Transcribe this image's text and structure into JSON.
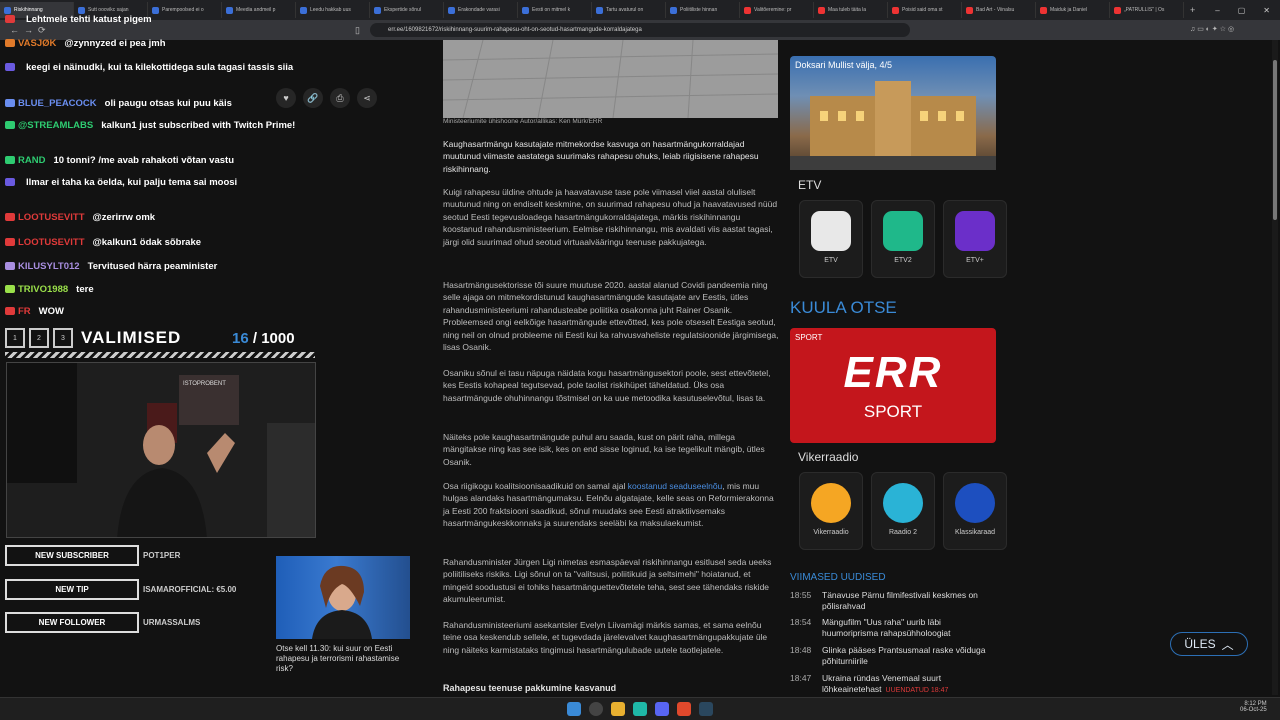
{
  "tabs": [
    {
      "label": "Riskihinnang",
      "active": true,
      "icon": "err-favicon"
    },
    {
      "label": "Sutt ooovikc sajan",
      "icon": "err-favicon"
    },
    {
      "label": "Parempoolsed ei o",
      "icon": "err-favicon"
    },
    {
      "label": "Meedia andmeil p",
      "icon": "err-favicon"
    },
    {
      "label": "Leedu hakkab uus",
      "icon": "err-favicon"
    },
    {
      "label": "Ekspertide sõnul",
      "icon": "err-favicon"
    },
    {
      "label": "Erakondade varasi",
      "icon": "err-favicon"
    },
    {
      "label": "Eesti on mitmel k",
      "icon": "err-favicon"
    },
    {
      "label": "Tartu avaturul on",
      "icon": "err-favicon"
    },
    {
      "label": "Poliitiliste hinnan",
      "icon": "err-favicon"
    },
    {
      "label": "Valitõeremine: pr",
      "icon": "red-favicon"
    },
    {
      "label": "Maa tuleb täita la",
      "icon": "red-favicon"
    },
    {
      "label": "Poisid said oma st",
      "icon": "red-favicon"
    },
    {
      "label": "Bad Art - Viinalsu",
      "icon": "youtube-favicon"
    },
    {
      "label": "Maiduk ja Daniel",
      "icon": "youtube-favicon"
    },
    {
      "label": "„PATRULLIS\" | Os",
      "icon": "youtube-favicon"
    }
  ],
  "address": {
    "url": "err.ee/1609821672/riskihinnang-suurim-rahapesu-oht-on-seotud-hasartmangude-korraldajatega"
  },
  "chat": [
    {
      "user": "",
      "text": "Lehtmele tehti katust pigem",
      "color": "#e03a3a"
    },
    {
      "user": "VASJØK",
      "text": "@zynnyzed ei pea jmh",
      "color": "#e07a2a"
    },
    {
      "user": "",
      "text": "keegi ei näinudki, kui ta kilekottidega sula tagasi tassis siia",
      "color": "#6a5ae0"
    },
    {
      "user": "BLUE_PEACOCK",
      "text": "oli paugu otsas kui puu käis",
      "color": "#6a8ef0"
    },
    {
      "user": "@STREAMLABS",
      "text": "kalkun1 just subscribed with Twitch Prime!",
      "color": "#2ecc71"
    },
    {
      "user": "RAND",
      "text": "10 tonni? /me avab rahakoti võtan vastu",
      "color": "#2ecc71"
    },
    {
      "user": "",
      "text": "Ilmar ei taha ka öelda, kui palju tema sai moosi",
      "color": "#6a5ae0"
    },
    {
      "user": "LOOTUSEVITT",
      "text": "@zerirrw omk",
      "color": "#e03a3a"
    },
    {
      "user": "LOOTUSEVITT",
      "text": "@kalkun1 ödak sõbrake",
      "color": "#e03a3a"
    },
    {
      "user": "KILUSYLT012",
      "text": "Tervitused härra peaminister",
      "color": "#a88ee0"
    },
    {
      "user": "TRIVO1988",
      "text": "tere",
      "color": "#9ae04a"
    },
    {
      "user": "FR",
      "text": "WOW",
      "color": "#e03a3a"
    }
  ],
  "vote": {
    "tabs": [
      "1",
      "2",
      "3"
    ],
    "title": "VALIMISED",
    "current": "16",
    "total": "/ 1000"
  },
  "cam": {
    "poster_text": "ISTOPROBENT"
  },
  "alerts": [
    {
      "label": "NEW SUBSCRIBER",
      "value": "POT1PER"
    },
    {
      "label": "NEW TIP",
      "value": "ISAMAROFFICIAL: €5.00"
    },
    {
      "label": "NEW FOLLOWER",
      "value": "URMASSALMS"
    }
  ],
  "share_icons": [
    "heart-icon",
    "link-icon",
    "print-icon",
    "share-icon"
  ],
  "related": {
    "caption": "Otse kell 11.30: kui suur on Eesti rahapesu ja terrorismi rahastamise risk?"
  },
  "article": {
    "image_caption": "Ministeeriumite ühishoone Autor/allikas: Ken Mürk/ERR",
    "lead": "Kaughasartmängu kasutajate mitmekordse kasvuga on hasartmängukorraldajad muutunud viimaste aastatega suurimaks rahapesu ohuks, leiab riigisisene rahapesu riskihinnang.",
    "p1": "Kuigi rahapesu üldine ohtude ja haavatavuse tase pole viimasel viiel aastal oluliselt muutunud ning on endiselt keskmine, on suurimad rahapesu ohud ja haavatavused nüüd seotud Eesti tegevusloadega hasartmängukorraldajatega, märkis riskihinnangu koostanud rahandusministeerium. Eelmise riskihinnangu, mis avaldati viis aastat tagasi, järgi olid suurimad ohud seotud virtuaalvääringu teenuse pakkujatega.",
    "p2": "Hasartmängusektorisse tõi suure muutuse 2020. aastal alanud Covidi pandeemia ning selle ajaga on mitmekordistunud kaughasartmängude kasutajate arv Eestis, ütles rahandusministeeriumi rahandusteabe poliitika osakonna juht Rainer Osanik. Probleemsed ongi eelkõige hasartmängude ettevõtted, kes pole otseselt Eestiga seotud, ning neil on olnud probleeme nii Eesti kui ka rahvusvaheliste regulatsioonide järgimisega, lisas Osanik.",
    "p3": "Osaniku sõnul ei tasu näpuga näidata kogu hasartmängusektori poole, sest ettevõtetel, kes Eestis kohapeal tegutsevad, pole taolist riskihüpet täheldatud. Üks osa hasartmängude ohuhinnangu tõstmisel on ka uue metoodika kasutuselevõtul, lisas ta.",
    "p4": "Näiteks pole kaughasartmängude puhul aru saada, kust on pärit raha, millega mängitakse ning kas see isik, kes on end sisse loginud, ka ise tegelikult mängib, ütles Osanik.",
    "p5_pre": "Osa riigikogu koalitsioonisaadikuid on samal ajal ",
    "p5_link": "koostanud seaduseelnõu",
    "p5_post": ", mis muu hulgas alandaks hasartmängumaksu. Eelnõu algatajate, kelle seas on Reformierakonna ja Eesti 200 fraktsiooni saadikud, sõnul muudaks see Eesti atraktiivsemaks hasartmängukeskkonnaks ja suurendaks seeläbi ka maksulaekumist.",
    "p6": "Rahandusminister Jürgen Ligi nimetas esmaspäeval riskihinnangu esitlusel seda ueeks poliitiliseks riskiks. Ligi sõnul on ta \"valitsusi, poliitikuid ja seltsimehi\" hoiatanud, et mingeid soodustusi ei tohiks hasartmänguettevõtetele teha, sest see tähendaks riskide akumuleerumist.",
    "p7": "Rahandusministeeriumi asekantsler Evelyn Liivamägi märkis samas, et sama eelnõu teine osa keskendub sellele, et tugevdada järelevalvet kaughasartmängupakkujate üle ning näiteks karmistataks tingimusi hasartmängulubade uutele taotlejatele.",
    "subheading": "Rahapesu teenuse pakkumine kasvanud"
  },
  "sidebar": {
    "promo_text": "Doksari Mullist välja, 4/5",
    "etv_heading": "ETV",
    "etv_channels": [
      {
        "label": "ETV",
        "color": "#e8e8e8"
      },
      {
        "label": "ETV2",
        "color": "#1fb88a"
      },
      {
        "label": "ETV+",
        "color": "#6b2fc9"
      }
    ],
    "kuula": "KUULA OTSE",
    "sport_label": "SPORT",
    "sport_logo": "ERR",
    "sport_sub": "SPORT",
    "vikerraadio_heading": "Vikerraadio",
    "radio": [
      {
        "label": "Vikerraadio",
        "color": "#f5a623"
      },
      {
        "label": "Raadio 2",
        "color": "#2ab3d6"
      },
      {
        "label": "Klassikaraad",
        "color": "#1d4fbf"
      }
    ],
    "latest_heading": "VIIMASED UUDISED",
    "latest": [
      {
        "time": "18:55",
        "title": "Tänavuse Pärnu filmifestivali keskmes on põlisrahvad"
      },
      {
        "time": "18:54",
        "title": "Mängufilm \"Uus raha\" uurib läbi huumoriprisma rahapsühholoogiat"
      },
      {
        "time": "18:48",
        "title": "Glinka pääses Prantsusmaal raske võiduga põhiturniirile"
      },
      {
        "time": "18:47",
        "title": "Ukraina ründas Venemaal suurt lõhkeainetehast",
        "updated": "UUENDATUD 18:47"
      }
    ]
  },
  "ules": "ÜLES",
  "clock": {
    "time": "8:12 PM",
    "date": "06-Oct-25"
  }
}
